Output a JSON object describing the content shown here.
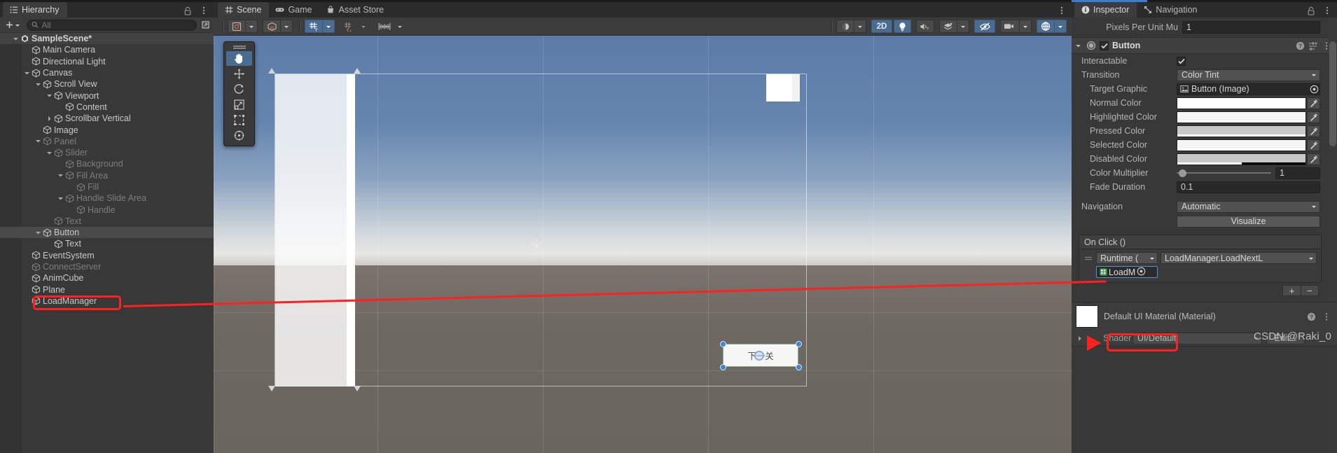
{
  "hierarchy": {
    "tab_label": "Hierarchy",
    "tab_icon": "hierarchy-icon",
    "add_label": "+",
    "search_placeholder": "All",
    "search_value": "",
    "items": [
      {
        "label": "SampleScene*",
        "depth": 1,
        "arrow": "down",
        "icon": "unity-scene-icon",
        "state": "scene",
        "selected": false
      },
      {
        "label": "Main Camera",
        "depth": 2,
        "arrow": "none",
        "icon": "gameobject-icon",
        "state": "normal",
        "selected": false
      },
      {
        "label": "Directional Light",
        "depth": 2,
        "arrow": "none",
        "icon": "gameobject-icon",
        "state": "normal",
        "selected": false
      },
      {
        "label": "Canvas",
        "depth": 2,
        "arrow": "down",
        "icon": "gameobject-icon",
        "state": "normal",
        "selected": false
      },
      {
        "label": "Scroll View",
        "depth": 3,
        "arrow": "down",
        "icon": "gameobject-icon",
        "state": "normal",
        "selected": false
      },
      {
        "label": "Viewport",
        "depth": 4,
        "arrow": "down",
        "icon": "gameobject-icon",
        "state": "normal",
        "selected": false
      },
      {
        "label": "Content",
        "depth": 5,
        "arrow": "none",
        "icon": "gameobject-icon",
        "state": "normal",
        "selected": false
      },
      {
        "label": "Scrollbar Vertical",
        "depth": 4,
        "arrow": "right",
        "icon": "gameobject-icon",
        "state": "normal",
        "selected": false
      },
      {
        "label": "Image",
        "depth": 3,
        "arrow": "none",
        "icon": "gameobject-icon",
        "state": "normal",
        "selected": false
      },
      {
        "label": "Panel",
        "depth": 3,
        "arrow": "down",
        "icon": "gameobject-icon",
        "state": "dim",
        "selected": false
      },
      {
        "label": "Slider",
        "depth": 4,
        "arrow": "down",
        "icon": "gameobject-icon",
        "state": "dim",
        "selected": false
      },
      {
        "label": "Background",
        "depth": 5,
        "arrow": "none",
        "icon": "gameobject-icon",
        "state": "dim",
        "selected": false
      },
      {
        "label": "Fill Area",
        "depth": 5,
        "arrow": "down",
        "icon": "gameobject-icon",
        "state": "dim",
        "selected": false
      },
      {
        "label": "Fill",
        "depth": 6,
        "arrow": "none",
        "icon": "gameobject-icon",
        "state": "dim",
        "selected": false
      },
      {
        "label": "Handle Slide Area",
        "depth": 5,
        "arrow": "down",
        "icon": "gameobject-icon",
        "state": "dim",
        "selected": false
      },
      {
        "label": "Handle",
        "depth": 6,
        "arrow": "none",
        "icon": "gameobject-icon",
        "state": "dim",
        "selected": false
      },
      {
        "label": "Text",
        "depth": 4,
        "arrow": "none",
        "icon": "gameobject-icon",
        "state": "dim",
        "selected": false
      },
      {
        "label": "Button",
        "depth": 3,
        "arrow": "down",
        "icon": "gameobject-icon",
        "state": "normal",
        "selected": true
      },
      {
        "label": "Text",
        "depth": 4,
        "arrow": "none",
        "icon": "gameobject-icon",
        "state": "normal",
        "selected": false
      },
      {
        "label": "EventSystem",
        "depth": 2,
        "arrow": "none",
        "icon": "gameobject-icon",
        "state": "normal",
        "selected": false
      },
      {
        "label": "ConnectServer",
        "depth": 2,
        "arrow": "none",
        "icon": "gameobject-icon",
        "state": "dim",
        "selected": false
      },
      {
        "label": "AnimCube",
        "depth": 2,
        "arrow": "none",
        "icon": "gameobject-icon",
        "state": "normal",
        "selected": false
      },
      {
        "label": "Plane",
        "depth": 2,
        "arrow": "none",
        "icon": "gameobject-icon",
        "state": "normal",
        "selected": false
      },
      {
        "label": "LoadManager",
        "depth": 2,
        "arrow": "none",
        "icon": "gameobject-icon",
        "state": "normal",
        "selected": false,
        "highlighted": true
      }
    ]
  },
  "scene_panel": {
    "tabs": [
      {
        "label": "Scene",
        "icon": "grid-icon",
        "active": true
      },
      {
        "label": "Game",
        "icon": "gamepad-icon",
        "active": false
      },
      {
        "label": "Asset Store",
        "icon": "store-icon",
        "active": false
      }
    ],
    "toolbar_left": [
      {
        "name": "shading-mode-button",
        "icon": "shaded-icon",
        "active": false,
        "has_dropdown": true
      },
      {
        "name": "draw-mode-button",
        "icon": "wireframe-cube-icon",
        "active": false,
        "has_dropdown": true
      },
      {
        "name": "2d-grid-button",
        "icon": "grid-axis-y-icon",
        "active": true,
        "has_dropdown": true
      },
      {
        "name": "grid-snap-button",
        "icon": "grid-snap-icon",
        "active": false,
        "has_dropdown": true
      },
      {
        "name": "ruler-button",
        "icon": "ruler-icon",
        "active": false,
        "has_dropdown": true
      }
    ],
    "toolbar_right": [
      {
        "name": "gizmo-lighting-button",
        "icon": "sphere-icon",
        "active": false,
        "has_dropdown": true
      },
      {
        "name": "2d-toggle-button",
        "label": "2D",
        "active": true
      },
      {
        "name": "scene-lighting-button",
        "icon": "lightbulb-icon",
        "active": true
      },
      {
        "name": "audio-toggle-button",
        "icon": "mute-audio-icon",
        "active": false
      },
      {
        "name": "fx-button",
        "icon": "fx-layers-icon",
        "active": false,
        "has_dropdown": true
      },
      {
        "name": "hidden-objects-button",
        "icon": "eye-off-icon",
        "active": true
      },
      {
        "name": "camera-settings-button",
        "icon": "camera-icon",
        "active": false,
        "has_dropdown": true
      },
      {
        "name": "gizmos-button",
        "icon": "gizmo-globe-icon",
        "active": true,
        "has_dropdown": true
      }
    ],
    "tool_palette": [
      {
        "name": "hand-tool",
        "icon": "hand-icon",
        "active": true
      },
      {
        "name": "move-tool",
        "icon": "move-icon",
        "active": false
      },
      {
        "name": "rotate-tool",
        "icon": "rotate-icon",
        "active": false
      },
      {
        "name": "scale-tool",
        "icon": "scale-icon",
        "active": false
      },
      {
        "name": "rect-tool",
        "icon": "rect-icon",
        "active": false
      },
      {
        "name": "transform-tool",
        "icon": "transform-icon",
        "active": false
      }
    ],
    "selected_button_text": "下一关",
    "pivot_marker": "pivot-icon"
  },
  "inspector": {
    "tabs": [
      {
        "label": "Inspector",
        "icon": "info-icon",
        "active": true
      },
      {
        "label": "Navigation",
        "icon": "navigation-icon",
        "active": false
      }
    ],
    "lock_icon": "lock-icon",
    "menu_icon": "kebab-menu-icon",
    "pixels_per_unit": {
      "label": "Pixels Per Unit Mu",
      "value": "1"
    },
    "component": {
      "name": "Button",
      "enabled": true,
      "help_icon": "help-icon",
      "preset_icon": "preset-icon",
      "menu_icon": "kebab-menu-icon",
      "rows": [
        {
          "label": "Interactable",
          "type": "checkbox",
          "value": true,
          "indent": false
        },
        {
          "label": "Transition",
          "type": "dropdown",
          "value": "Color Tint",
          "indent": false
        },
        {
          "label": "Target Graphic",
          "type": "object",
          "value": "Button (Image)",
          "indent": true
        },
        {
          "label": "Normal Color",
          "type": "color",
          "value": "#ffffff",
          "alpha": 1.0,
          "indent": true
        },
        {
          "label": "Highlighted Color",
          "type": "color",
          "value": "#f5f5f5",
          "alpha": 1.0,
          "indent": true
        },
        {
          "label": "Pressed Color",
          "type": "color",
          "value": "#c8c8c8",
          "alpha": 1.0,
          "indent": true
        },
        {
          "label": "Selected Color",
          "type": "color",
          "value": "#f5f5f5",
          "alpha": 1.0,
          "indent": true
        },
        {
          "label": "Disabled Color",
          "type": "color",
          "value": "#c8c8c8",
          "alpha": 0.5,
          "indent": true
        },
        {
          "label": "Color Multiplier",
          "type": "slider",
          "value": "1",
          "knob_pct": 2,
          "indent": true
        },
        {
          "label": "Fade Duration",
          "type": "text",
          "value": "0.1",
          "indent": true
        },
        {
          "label": "Navigation",
          "type": "dropdown",
          "value": "Automatic",
          "indent": false
        }
      ],
      "visualize_label": "Visualize"
    },
    "on_click": {
      "title": "On Click ()",
      "event": {
        "runtime_label": "Runtime (",
        "function_label": "LoadManager.LoadNextL",
        "object_label": "LoadM",
        "object_icon": "script-icon",
        "picker_icon": "object-picker-icon"
      },
      "add_label": "+",
      "remove_label": "−"
    },
    "material": {
      "title": "Default UI Material (Material)",
      "help_icon": "help-icon",
      "menu_icon": "kebab-menu-icon",
      "shader_label": "Shader",
      "shader_value": "UI/Default",
      "edit_label": "Edit..."
    },
    "watermark": "CSDN @Raki_0"
  },
  "annotation": {
    "color": "#ff2020",
    "hierarchy_box": "LoadManager",
    "inspector_box": "LoadM"
  }
}
